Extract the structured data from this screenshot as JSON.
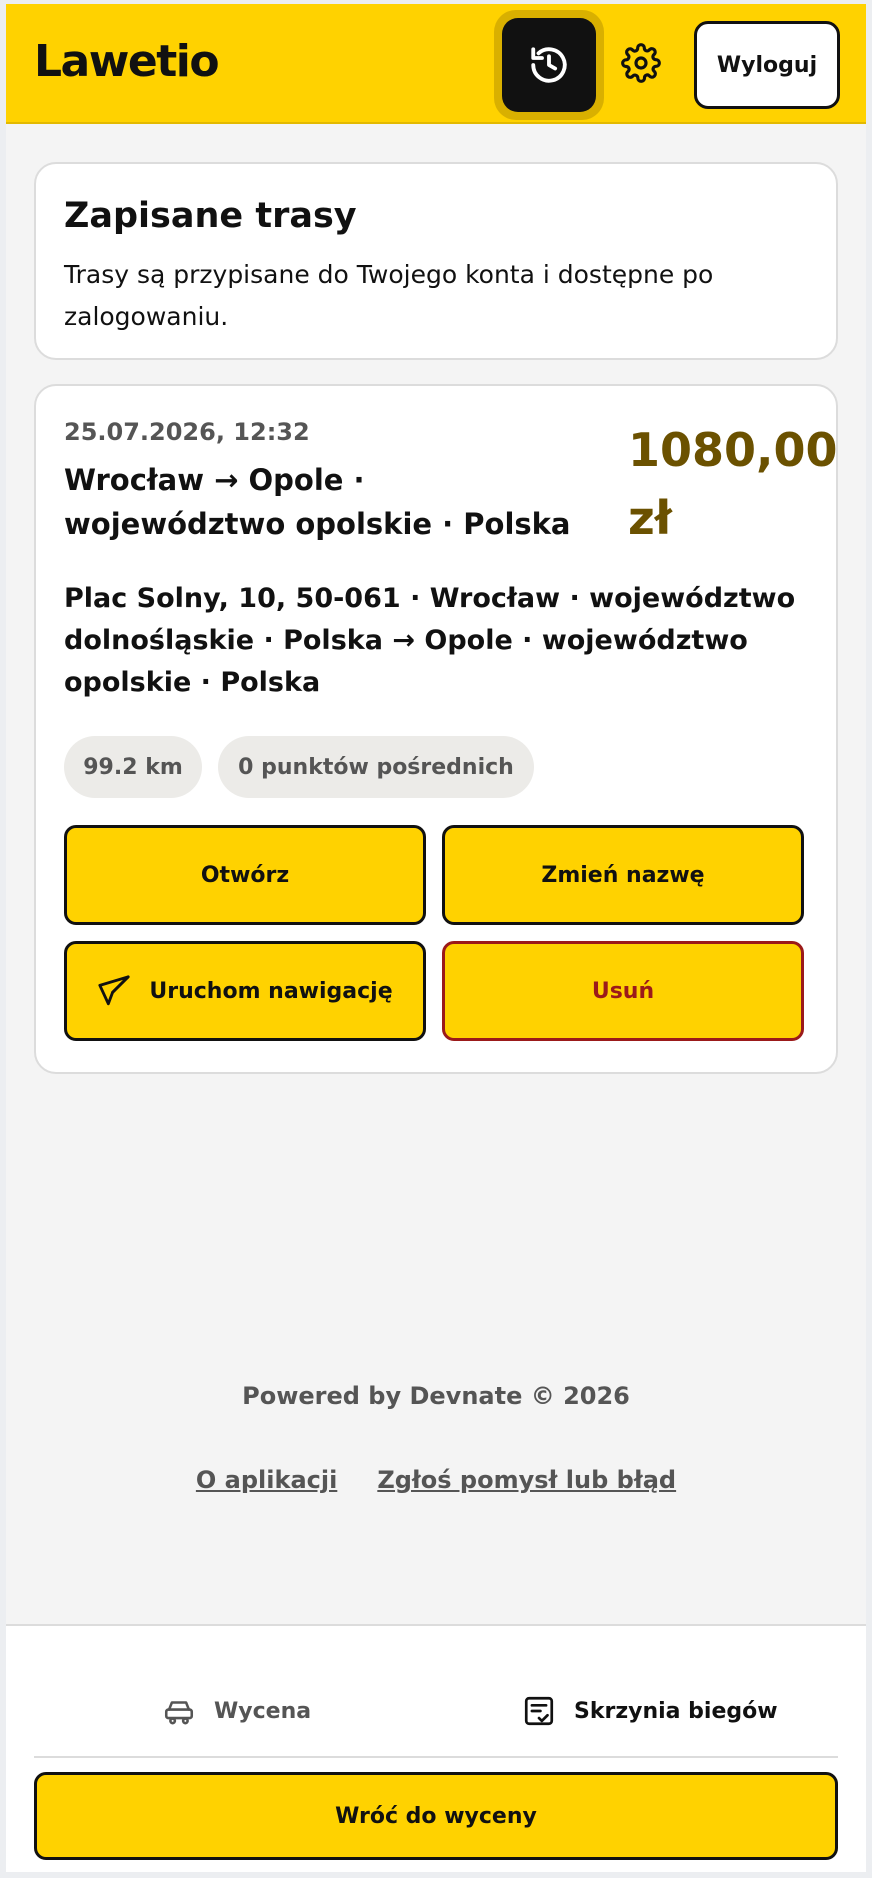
{
  "header": {
    "logo": "Lawetio",
    "history_icon": "history-icon",
    "settings_icon": "gear-icon",
    "logout_label": "Wyloguj"
  },
  "info_card": {
    "title": "Zapisane trasy",
    "description": "Trasy są przypisane do Twojego konta i dostępne po zalogowaniu."
  },
  "route_card": {
    "date": "25.07.2026, 12:32",
    "title": "Wrocław → Opole · województwo opolskie · Polska",
    "price": "1080,00 zł",
    "address": "Plac Solny, 10, 50-061 · Wrocław · województwo dolnośląskie · Polska → Opole · województwo opolskie · Polska",
    "distance": "99.2 km",
    "waypoints": "0 punktów pośrednich",
    "open_label": "Otwórz",
    "rename_label": "Zmień nazwę",
    "navigate_label": "Uruchom nawigację",
    "delete_label": "Usuń"
  },
  "footer": {
    "powered": "Powered by Devnate © 2026",
    "about_link": "O aplikacji",
    "report_link": "Zgłoś pomysł lub błąd"
  },
  "bottom_nav": {
    "wycena_label": "Wycena",
    "skrzynia_label": "Skrzynia biegów",
    "back_label": "Wróć do wyceny"
  },
  "colors": {
    "accent": "#ffd200",
    "price": "#6b5100",
    "danger": "#9b1a1a"
  }
}
